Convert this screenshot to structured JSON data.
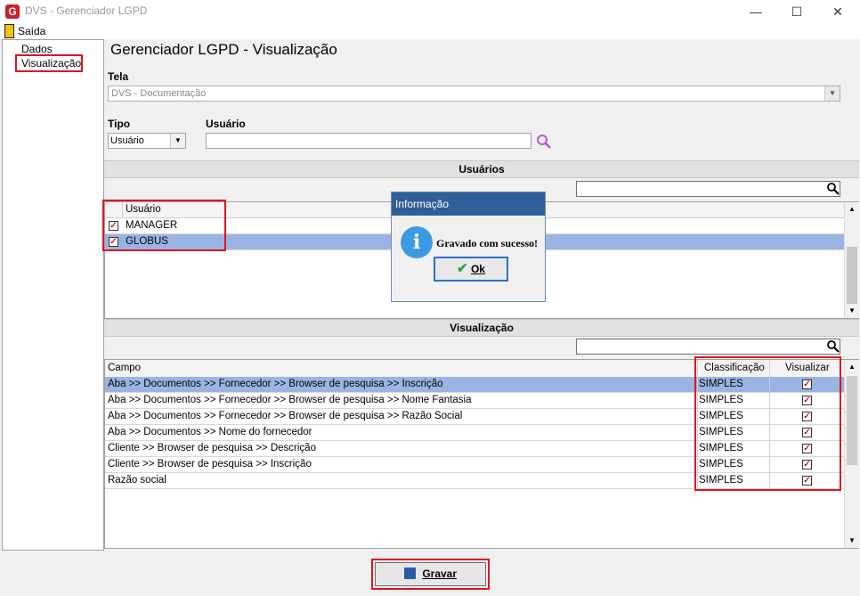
{
  "window": {
    "title": "DVS - Gerenciador LGPD",
    "logo_letter": "G"
  },
  "menu": {
    "exit_label": "Saída"
  },
  "tree": {
    "items": [
      {
        "label": "Dados"
      },
      {
        "label": "Visualização"
      }
    ]
  },
  "page": {
    "title": "Gerenciador LGPD - Visualização"
  },
  "tela": {
    "label": "Tela",
    "value": "DVS - Documentação"
  },
  "tipo": {
    "label": "Tipo",
    "value": "Usuário"
  },
  "usuario": {
    "label": "Usuário",
    "value": ""
  },
  "users_section": {
    "header": "Usuários",
    "column": "Usuário",
    "rows": [
      {
        "name": "MANAGER",
        "checked": true
      },
      {
        "name": "GLOBUS",
        "checked": true
      }
    ]
  },
  "vis_section": {
    "header": "Visualização",
    "columns": {
      "campo": "Campo",
      "classificacao": "Classificação",
      "visualizar": "Visualizar"
    },
    "rows": [
      {
        "campo": "Aba >> Documentos  >> Fornecedor >> Browser de pesquisa >> Inscrição",
        "classificacao": "SIMPLES",
        "visualizar": true
      },
      {
        "campo": "Aba >> Documentos  >> Fornecedor >> Browser de pesquisa >> Nome Fantasia",
        "classificacao": "SIMPLES",
        "visualizar": true
      },
      {
        "campo": "Aba >> Documentos  >> Fornecedor >> Browser de pesquisa >> Razão Social",
        "classificacao": "SIMPLES",
        "visualizar": true
      },
      {
        "campo": "Aba >> Documentos  >> Nome do fornecedor",
        "classificacao": "SIMPLES",
        "visualizar": true
      },
      {
        "campo": "Cliente >> Browser de pesquisa >> Descrição",
        "classificacao": "SIMPLES",
        "visualizar": true
      },
      {
        "campo": "Cliente >> Browser de pesquisa >> Inscrição",
        "classificacao": "SIMPLES",
        "visualizar": true
      },
      {
        "campo": "Razão social",
        "classificacao": "SIMPLES",
        "visualizar": true
      }
    ]
  },
  "dialog": {
    "title": "Informação",
    "message": "Gravado com sucesso!",
    "ok_label": "Ok"
  },
  "footer": {
    "save_label": "Gravar"
  },
  "colors": {
    "selection": "#99b4e3",
    "highlight_box": "#e0141e",
    "dialog_title": "#2f5f98"
  }
}
